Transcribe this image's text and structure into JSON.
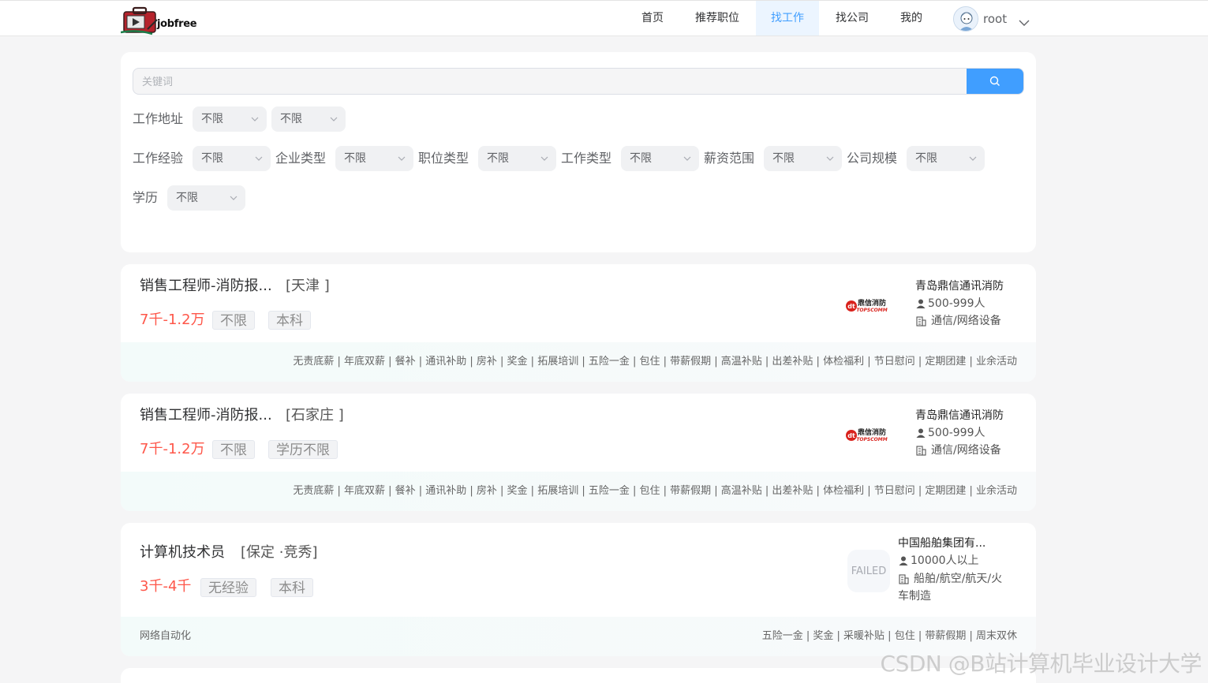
{
  "header": {
    "brand": "jobfree",
    "nav": [
      {
        "label": "首页"
      },
      {
        "label": "推荐职位"
      },
      {
        "label": "找工作"
      },
      {
        "label": "找公司"
      },
      {
        "label": "我的"
      }
    ],
    "active_nav": "找工作",
    "user": {
      "name": "root"
    }
  },
  "search": {
    "placeholder": "关键词",
    "value": ""
  },
  "filters": {
    "address": {
      "label": "工作地址",
      "province": "不限",
      "city": "不限"
    },
    "experience": {
      "label": "工作经验",
      "value": "不限"
    },
    "company_type": {
      "label": "企业类型",
      "value": "不限"
    },
    "position_type": {
      "label": "职位类型",
      "value": "不限"
    },
    "job_type": {
      "label": "工作类型",
      "value": "不限"
    },
    "salary": {
      "label": "薪资范围",
      "value": "不限"
    },
    "company_size": {
      "label": "公司规模",
      "value": "不限"
    },
    "education": {
      "label": "学历",
      "value": "不限"
    }
  },
  "jobs": [
    {
      "title": "销售工程师-消防报...",
      "city": "[天津 ]",
      "salary": "7千-1.2万",
      "tags": [
        "不限",
        "本科"
      ],
      "company": {
        "name": "青岛鼎信通讯消防",
        "size": "500-999人",
        "industry": "通信/网络设备",
        "logo_text": "鼎信消防",
        "logo_sub": "TOPSCOMM"
      },
      "skill": "",
      "welfare": "无责底薪 | 年底双薪 | 餐补 | 通讯补助 | 房补 | 奖金 | 拓展培训 | 五险一金 | 包住 | 带薪假期 | 高温补贴 | 出差补贴 | 体检福利 | 节日慰问 | 定期团建 | 业余活动"
    },
    {
      "title": "销售工程师-消防报...",
      "city": "[石家庄 ]",
      "salary": "7千-1.2万",
      "tags": [
        "不限",
        "学历不限"
      ],
      "company": {
        "name": "青岛鼎信通讯消防",
        "size": "500-999人",
        "industry": "通信/网络设备",
        "logo_text": "鼎信消防",
        "logo_sub": "TOPSCOMM"
      },
      "skill": "",
      "welfare": "无责底薪 | 年底双薪 | 餐补 | 通讯补助 | 房补 | 奖金 | 拓展培训 | 五险一金 | 包住 | 带薪假期 | 高温补贴 | 出差补贴 | 体检福利 | 节日慰问 | 定期团建 | 业余活动"
    },
    {
      "title": "计算机技术员",
      "city": "[保定 ·竞秀]",
      "salary": "3千-4千",
      "tags": [
        "无经验",
        "本科"
      ],
      "company": {
        "name": "中国船舶集团有...",
        "size": "10000人以上",
        "industry_line1": "船舶/航空/航天/火",
        "industry_line2": "车制造",
        "logo_text": "FAILED"
      },
      "skill": "网络自动化",
      "welfare": "五险一金 | 奖金 | 采暖补贴 | 包住 | 带薪假期 | 周末双休"
    }
  ],
  "watermark": "CSDN @B站计算机毕业设计大学",
  "colors": {
    "accent": "#409eff",
    "salary": "#fe574a",
    "logo_red": "#d9231d"
  }
}
